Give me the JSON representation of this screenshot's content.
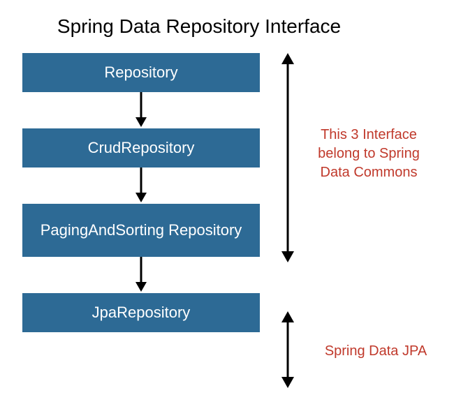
{
  "title": "Spring Data Repository Interface",
  "boxes": {
    "b1": "Repository",
    "b2": "CrudRepository",
    "b3": "PagingAndSorting Repository",
    "b4": "JpaRepository"
  },
  "annotations": {
    "a1": "This 3 Interface belong to Spring Data Commons",
    "a2": "Spring Data JPA"
  }
}
